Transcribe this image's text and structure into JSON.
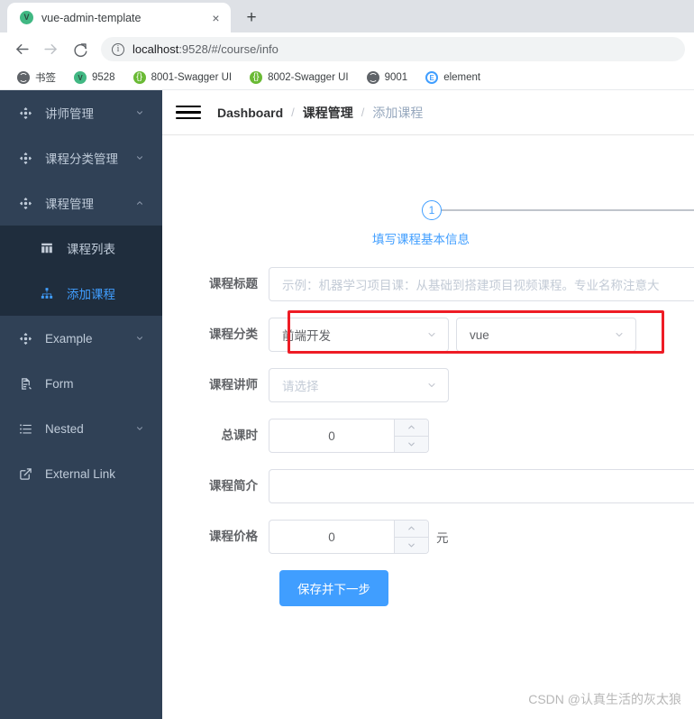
{
  "browser": {
    "tab": {
      "title": "vue-admin-template",
      "favicon": "vue-icon",
      "close": "×"
    },
    "new_tab": "+",
    "nav": {
      "back": "←",
      "forward": "→",
      "reload": "⟳"
    },
    "omnibox": {
      "info_icon": "i",
      "url_host": "localhost",
      "url_rest": ":9528/#/course/info"
    },
    "bookmarks": [
      {
        "label": "书签",
        "icon": "globe-icon",
        "glyph": ""
      },
      {
        "label": "9528",
        "icon": "vue-icon",
        "glyph": "V"
      },
      {
        "label": "8001-Swagger UI",
        "icon": "swagger-icon",
        "glyph": "{}"
      },
      {
        "label": "8002-Swagger UI",
        "icon": "swagger-icon",
        "glyph": "{}"
      },
      {
        "label": "9001",
        "icon": "globe-icon",
        "glyph": ""
      },
      {
        "label": "element",
        "icon": "element-icon",
        "glyph": "E"
      }
    ]
  },
  "sidebar": {
    "items": [
      {
        "label": "讲师管理",
        "icon": "component-icon",
        "chevron": "down"
      },
      {
        "label": "课程分类管理",
        "icon": "component-icon",
        "chevron": "down"
      },
      {
        "label": "课程管理",
        "icon": "component-icon",
        "chevron": "up"
      }
    ],
    "submenu": [
      {
        "label": "课程列表",
        "icon": "table-icon",
        "active": false
      },
      {
        "label": "添加课程",
        "icon": "tree-icon",
        "active": true
      }
    ],
    "items_after": [
      {
        "label": "Example",
        "icon": "component-icon",
        "chevron": "down"
      },
      {
        "label": "Form",
        "icon": "form-icon",
        "chevron": ""
      },
      {
        "label": "Nested",
        "icon": "nested-icon",
        "chevron": "down"
      },
      {
        "label": "External Link",
        "icon": "external-link-icon",
        "chevron": ""
      }
    ]
  },
  "navbar": {
    "hamburger": "hamburger-icon",
    "breadcrumb": [
      {
        "label": "Dashboard",
        "muted": false
      },
      {
        "label": "课程管理",
        "muted": false
      },
      {
        "label": "添加课程",
        "muted": true
      }
    ],
    "separator": "/"
  },
  "steps": {
    "current": "1",
    "title": "填写课程基本信息"
  },
  "form": {
    "title": {
      "label": "课程标题",
      "value": "",
      "placeholder": "示例：机器学习项目课：从基础到搭建项目视频课程。专业名称注意大"
    },
    "category": {
      "label": "课程分类",
      "parent_value": "前端开发",
      "child_value": "vue"
    },
    "teacher": {
      "label": "课程讲师",
      "value": "",
      "placeholder": "请选择"
    },
    "lessons": {
      "label": "总课时",
      "value": "0"
    },
    "intro": {
      "label": "课程简介",
      "value": ""
    },
    "price": {
      "label": "课程价格",
      "value": "0",
      "unit": "元"
    },
    "submit": "保存并下一步"
  },
  "annotation": {
    "color": "#ee1c25"
  },
  "watermark": "CSDN @认真生活的灰太狼",
  "colors": {
    "sidebar_bg": "#304156",
    "submenu_bg": "#1f2d3d",
    "accent": "#409eff",
    "annotation": "#ee1c25"
  }
}
